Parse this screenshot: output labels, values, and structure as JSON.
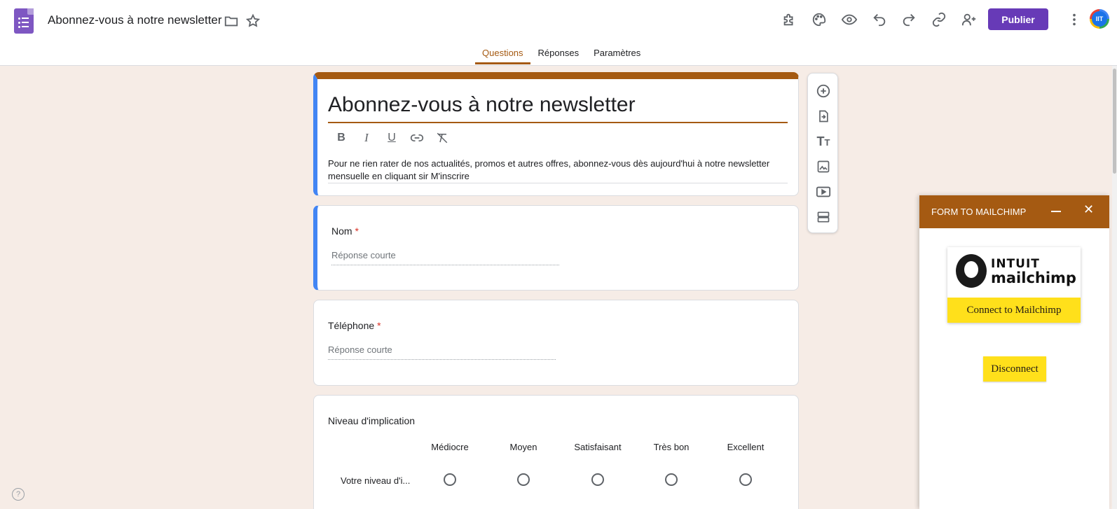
{
  "header": {
    "doc_title": "Abonnez-vous à notre newsletter",
    "publish_label": "Publier",
    "avatar_initials": "IIT",
    "icons": [
      "addons-icon",
      "palette-icon",
      "preview-eye-icon",
      "undo-icon",
      "redo-icon",
      "link-icon",
      "add-collaborator-icon",
      "more-vert-icon"
    ]
  },
  "tabs": [
    {
      "label": "Questions",
      "active": true
    },
    {
      "label": "Réponses",
      "active": false
    },
    {
      "label": "Paramètres",
      "active": false
    }
  ],
  "form": {
    "title": "Abonnez-vous à notre newsletter",
    "description": "Pour ne rien rater de nos actualités, promos et autres offres, abonnez-vous dès aujourd'hui à notre newsletter mensuelle en cliquant sir M'inscrire",
    "questions": [
      {
        "label": "Nom",
        "required_mark": "*",
        "placeholder": "Réponse courte"
      },
      {
        "label": "Téléphone",
        "required_mark": "*",
        "placeholder": "Réponse courte"
      }
    ],
    "grid": {
      "label": "Niveau d'implication",
      "columns": [
        "Médiocre",
        "Moyen",
        "Satisfaisant",
        "Très bon",
        "Excellent"
      ],
      "row_label": "Votre niveau d'i..."
    }
  },
  "side_tools": [
    "add-question-icon",
    "import-questions-icon",
    "add-title-icon",
    "add-image-icon",
    "add-video-icon",
    "add-section-icon"
  ],
  "mailchimp": {
    "panel_title": "FORM TO MAILCHIMP",
    "logo_line1": "INTUIT",
    "logo_line2": "mailchimp",
    "connect_label": "Connect to Mailchimp",
    "disconnect_label": "Disconnect",
    "brand_yellow": "#ffe01b"
  },
  "colors": {
    "accent": "#a55a12",
    "publish": "#673ab7",
    "background": "#f6ece6",
    "selected_card": "#4285f4"
  }
}
